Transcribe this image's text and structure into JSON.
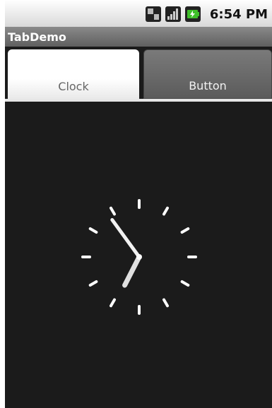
{
  "status_bar": {
    "time": "6:54 PM",
    "icons": [
      "usb-debug-icon",
      "signal-strength-icon",
      "battery-charging-icon"
    ]
  },
  "app": {
    "title": "TabDemo"
  },
  "tabs": [
    {
      "label": "Clock",
      "selected": true
    },
    {
      "label": "Button",
      "selected": false
    }
  ],
  "clock": {
    "type": "analog",
    "hour": 6,
    "minute": 54
  },
  "colors": {
    "background": "#1b1b1b",
    "tab_selected": "#ffffff",
    "tab_unselected": "#6a6a6a",
    "title_bar": "#707070"
  }
}
